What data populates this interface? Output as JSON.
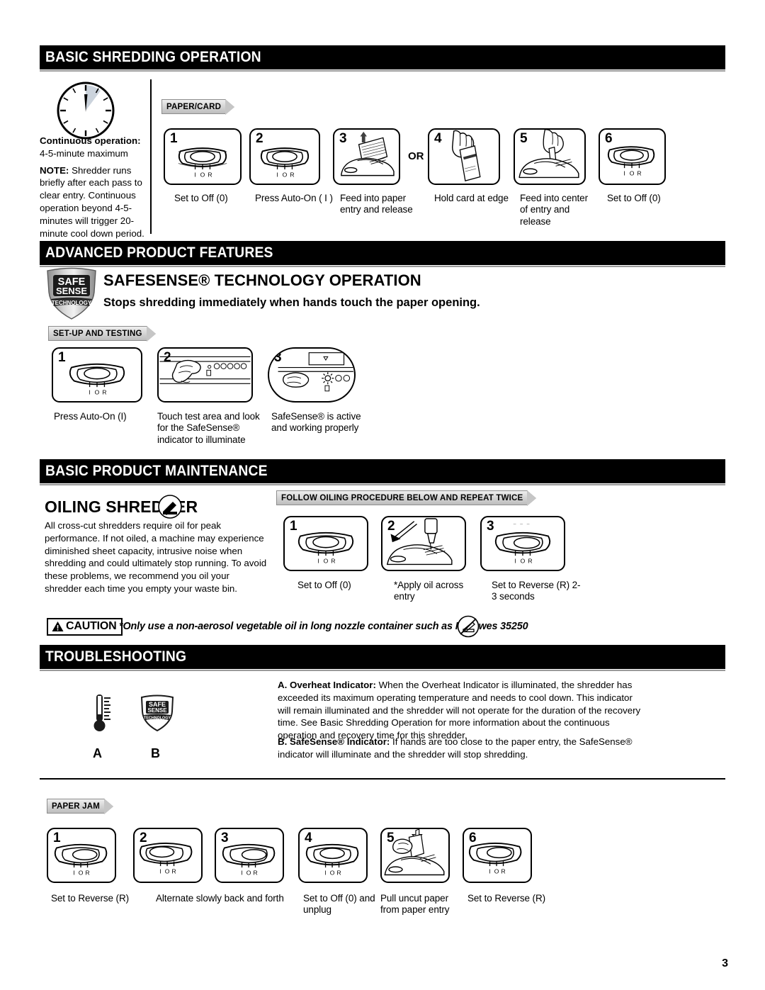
{
  "page": {
    "number": "3"
  },
  "sections": {
    "basic_shredding": {
      "title": "BASIC SHREDDING OPERATION",
      "clock_icon": "clock-icon",
      "notes": {
        "continuous_label": "Continuous operation:",
        "continuous_value": "4-5-minute maximum",
        "note_label": "NOTE:",
        "note_body": "Shredder runs briefly after each pass to clear entry. Continuous operation beyond 4-5-minutes will trigger 20-minute cool down period."
      },
      "tab": "PAPER/CARD",
      "or_label": "OR",
      "steps": [
        {
          "num": "1",
          "caption": "Set to Off (0)",
          "art": "control-switch-off"
        },
        {
          "num": "2",
          "caption": "Press Auto-On ( I )",
          "art": "control-switch-on"
        },
        {
          "num": "3",
          "caption": "Feed into paper entry and release",
          "art": "paper-into-entry"
        },
        {
          "num": "4",
          "caption": "Hold card at edge",
          "art": "hand-holding-card"
        },
        {
          "num": "5",
          "caption": "Feed into center of entry and release",
          "art": "card-into-center"
        },
        {
          "num": "6",
          "caption": "Set to Off (0)",
          "art": "control-switch-off"
        }
      ]
    },
    "advanced_features": {
      "title": "ADVANCED PRODUCT FEATURES",
      "logo": {
        "line1": "SAFE",
        "line2": "SENSE",
        "line3": "TECHNOLOGY"
      },
      "heading": "SAFESENSE® TECHNOLOGY OPERATION",
      "subheading": "Stops shredding immediately when hands touch the paper opening.",
      "tab": "SET-UP AND TESTING",
      "steps": [
        {
          "num": "1",
          "caption": "Press Auto-On (I)",
          "art": "control-switch-on"
        },
        {
          "num": "2",
          "caption": "Touch test area and look for the SafeSense® indicator to illuminate",
          "art": "hand-touch-test-area"
        },
        {
          "num": "3",
          "caption": "SafeSense® is active and working properly",
          "art": "safesense-indicator-lit"
        }
      ]
    },
    "maintenance": {
      "title": "BASIC PRODUCT MAINTENANCE",
      "heading": "OILING SHREDDER",
      "oil_icon": "oil-bottle-icon",
      "body": "All cross-cut shredders require oil for peak performance. If not oiled, a machine may experience diminished sheet capacity, intrusive noise when shredding and could ultimately stop running. To avoid these problems, we recommend you oil your shredder each time you empty your waste bin.",
      "tab": "FOLLOW OILING PROCEDURE BELOW AND REPEAT TWICE",
      "steps": [
        {
          "num": "1",
          "caption": "Set to Off (0)",
          "art": "control-switch-off"
        },
        {
          "num": "2",
          "caption": "*Apply oil across entry",
          "art": "oil-across-entry"
        },
        {
          "num": "3",
          "caption": "Set to Reverse (R) 2-3 seconds",
          "art": "control-switch-reverse"
        }
      ],
      "caution": {
        "label": "CAUTION",
        "icon": "warning-triangle-icon",
        "text": "*Only use a non-aerosol vegetable oil in long nozzle container such as Fellowes 35250",
        "no_aerosol_icon": "no-aerosol-icon"
      }
    },
    "troubleshooting": {
      "title": "TROUBLESHOOTING",
      "indicators": [
        {
          "letter": "A",
          "icon": "thermometer-icon"
        },
        {
          "letter": "B",
          "icon": "safesense-shield-icon"
        }
      ],
      "items": [
        {
          "label": "A. Overheat Indicator:",
          "text": "When the Overheat Indicator is illuminated, the shredder has exceeded its maximum operating temperature and needs to cool down. This indicator will remain illuminated and the shredder will not operate for the duration of the recovery time. See Basic Shredding Operation for more information about the continuous operation and recovery time for this shredder."
        },
        {
          "label": "B. SafeSense® Indicator:",
          "text": "If hands are too close to the paper entry, the SafeSense® indicator will illuminate and the shredder will stop shredding."
        }
      ],
      "tab": "PAPER JAM",
      "steps": [
        {
          "num": "1",
          "caption": "Set to Reverse (R)",
          "art": "control-switch-reverse"
        },
        {
          "num": "2",
          "caption": "Alternate slowly back and forth",
          "art": "control-switch-alt-left"
        },
        {
          "num": "3",
          "caption": "",
          "art": "control-switch-alt-right"
        },
        {
          "num": "4",
          "caption": "Set to Off (0) and unplug",
          "art": "control-switch-off"
        },
        {
          "num": "5",
          "caption": "Pull uncut paper from paper entry",
          "art": "pull-paper-out"
        },
        {
          "num": "6",
          "caption": "Set to Reverse (R)",
          "art": "control-switch-reverse"
        }
      ]
    }
  },
  "switch_labels": {
    "i": "I",
    "o": "O",
    "r": "R"
  }
}
